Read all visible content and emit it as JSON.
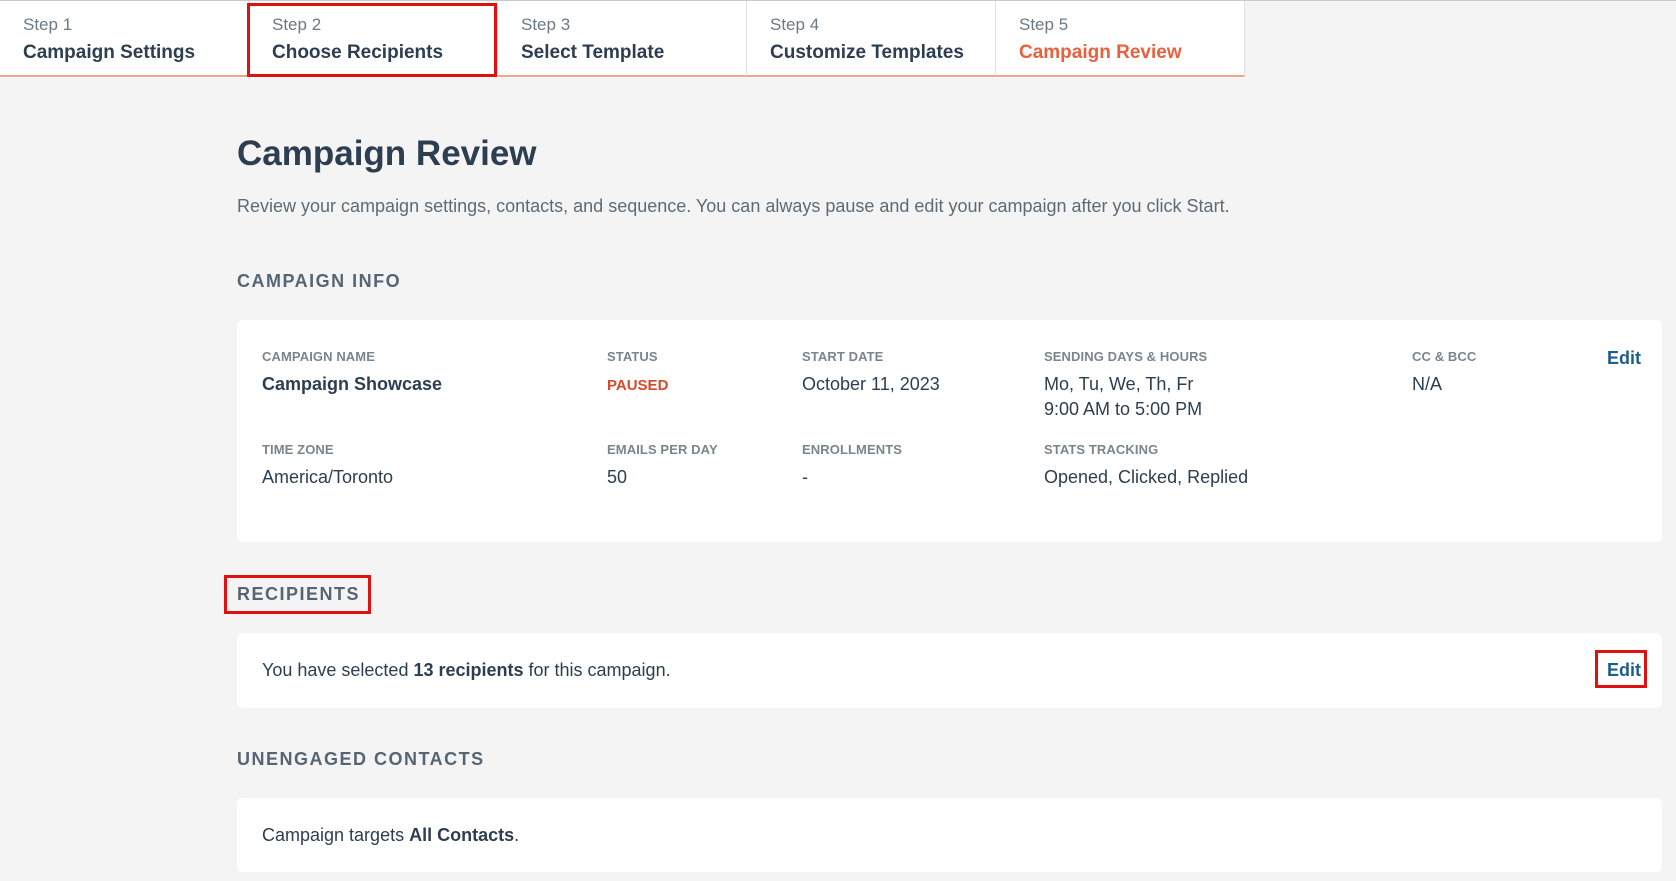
{
  "stepper": {
    "steps": [
      {
        "number": "Step 1",
        "title": "Campaign Settings"
      },
      {
        "number": "Step 2",
        "title": "Choose Recipients"
      },
      {
        "number": "Step 3",
        "title": "Select Template"
      },
      {
        "number": "Step 4",
        "title": "Customize Templates"
      },
      {
        "number": "Step 5",
        "title": "Campaign Review"
      }
    ],
    "active_step": "Step 5"
  },
  "page": {
    "title": "Campaign Review",
    "subtitle": "Review your campaign settings, contacts, and sequence. You can always pause and edit your campaign after you click Start."
  },
  "campaign_info": {
    "heading": "CAMPAIGN INFO",
    "edit_label": "Edit",
    "fields": {
      "campaign_name": {
        "label": "CAMPAIGN NAME",
        "value": "Campaign Showcase"
      },
      "status": {
        "label": "STATUS",
        "value": "PAUSED"
      },
      "start_date": {
        "label": "START DATE",
        "value": "October 11, 2023"
      },
      "sending": {
        "label": "SENDING DAYS & HOURS",
        "days": "Mo, Tu, We, Th, Fr",
        "hours": "9:00 AM to 5:00 PM"
      },
      "cc_bcc": {
        "label": "CC & BCC",
        "value": "N/A"
      },
      "time_zone": {
        "label": "TIME ZONE",
        "value": "America/Toronto"
      },
      "emails_per_day": {
        "label": "EMAILS PER DAY",
        "value": "50"
      },
      "enrollments": {
        "label": "ENROLLMENTS",
        "value": "-"
      },
      "stats_tracking": {
        "label": "STATS TRACKING",
        "value": "Opened, Clicked, Replied"
      }
    }
  },
  "recipients": {
    "heading": "RECIPIENTS",
    "text_before": "You have selected ",
    "count_text": "13 recipients",
    "text_after": " for this campaign.",
    "edit_label": "Edit"
  },
  "unengaged": {
    "heading": "UNENGAGED CONTACTS",
    "text_before": "Campaign targets ",
    "target": "All Contacts",
    "text_after": "."
  },
  "colors": {
    "accent": "#e8603c",
    "link": "#1d5f8a",
    "status_paused": "#d64a2b",
    "highlight": "#e01010",
    "background": "#f4f4f4"
  }
}
